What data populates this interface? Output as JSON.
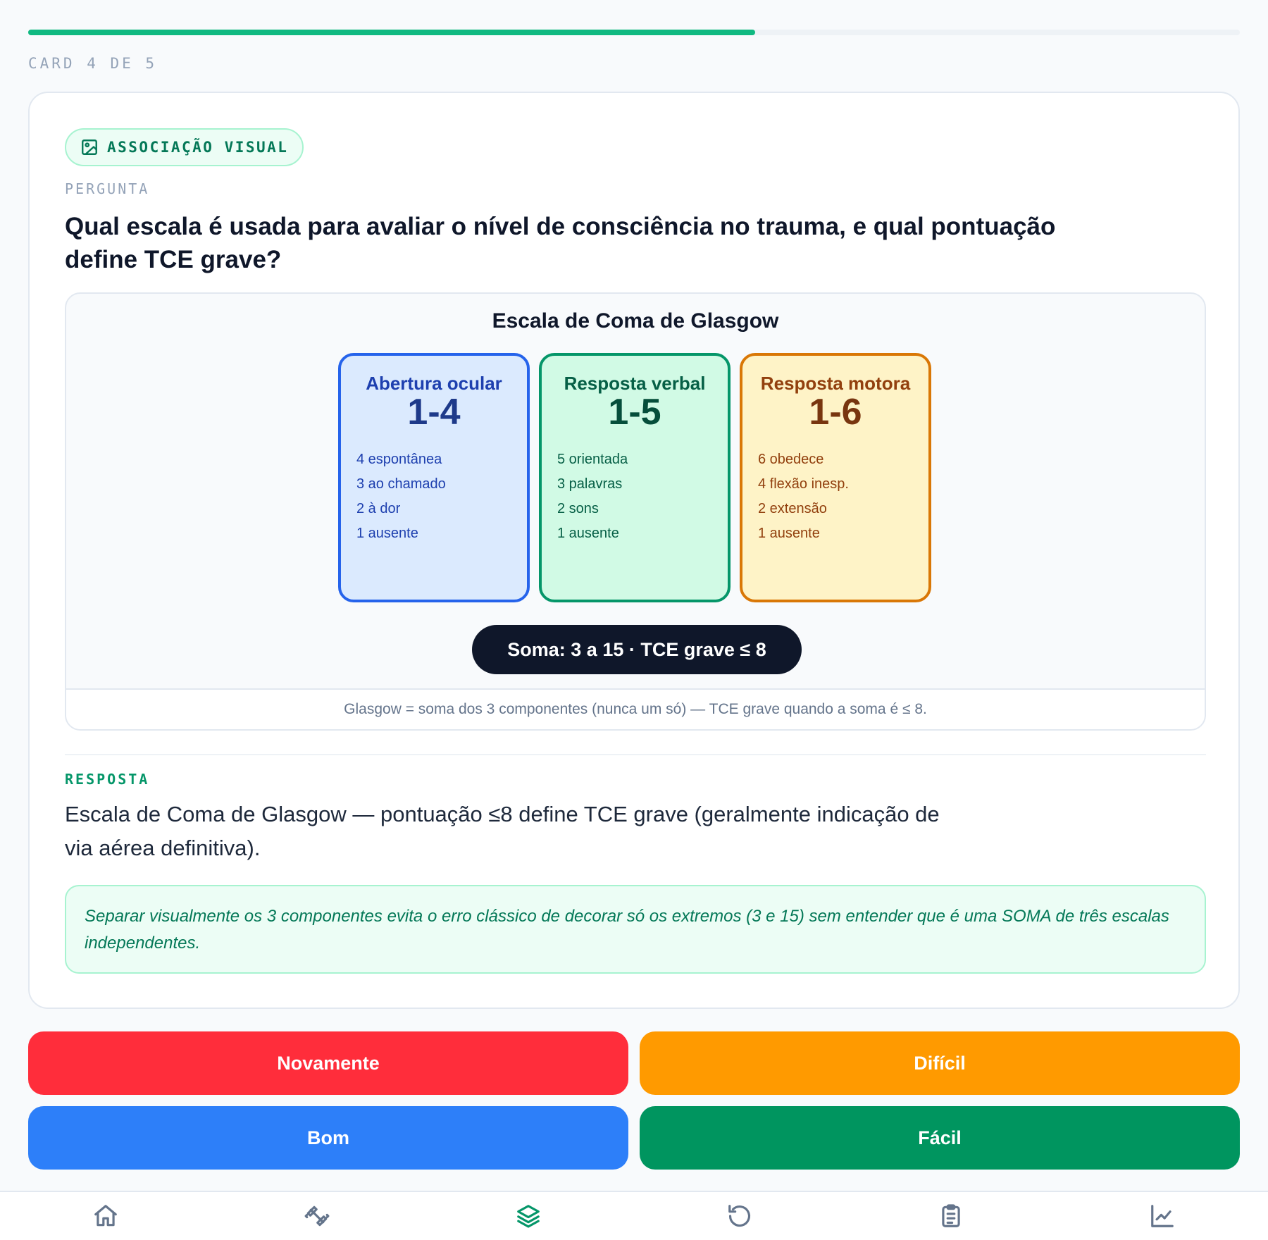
{
  "progress": {
    "current": 4,
    "total": 5,
    "fraction": 0.6,
    "label": "CARD 4 DE 5"
  },
  "card": {
    "badge": {
      "icon": "image-icon",
      "label": "ASSOCIAÇÃO VISUAL"
    },
    "question_label": "PERGUNTA",
    "question": "Qual escala é usada para avaliar o nível de consciência no trauma, e qual pontuação define TCE grave?",
    "figure": {
      "title": "Escala de Coma de Glasgow",
      "components": [
        {
          "name": "Abertura ocular",
          "range": "1-4",
          "items": [
            "4 espontânea",
            "3 ao chamado",
            "2 à dor",
            "1 ausente"
          ]
        },
        {
          "name": "Resposta verbal",
          "range": "1-5",
          "items": [
            "5 orientada",
            "3 palavras",
            "2 sons",
            "1 ausente"
          ]
        },
        {
          "name": "Resposta motora",
          "range": "1-6",
          "items": [
            "6 obedece",
            "4 flexão inesp.",
            "2 extensão",
            "1 ausente"
          ]
        }
      ],
      "sum_label": "Soma: 3 a 15 · TCE grave ≤ 8",
      "caption": "Glasgow = soma dos 3 componentes (nunca um só) — TCE grave quando a soma é ≤ 8."
    },
    "answer_label": "RESPOSTA",
    "answer": "Escala de Coma de Glasgow — pontuação ≤8 define TCE grave (geralmente indicação de via aérea definitiva).",
    "note": "Separar visualmente os 3 componentes evita o erro clássico de decorar só os extremos (3 e 15) sem entender que é uma SOMA de três escalas independentes."
  },
  "buttons": {
    "again": "Novamente",
    "hard": "Difícil",
    "good": "Bom",
    "easy": "Fácil"
  },
  "colors": {
    "accent": "#10b981",
    "again": "#ff2d3b",
    "hard": "#ff9a00",
    "good": "#2d7ff9",
    "easy": "#00955f"
  },
  "nav": {
    "items": [
      {
        "icon": "home-icon",
        "active": false
      },
      {
        "icon": "dumbbell-icon",
        "active": false
      },
      {
        "icon": "layers-icon",
        "active": true
      },
      {
        "icon": "history-icon",
        "active": false
      },
      {
        "icon": "clipboard-icon",
        "active": false
      },
      {
        "icon": "chart-line-icon",
        "active": false
      }
    ]
  }
}
